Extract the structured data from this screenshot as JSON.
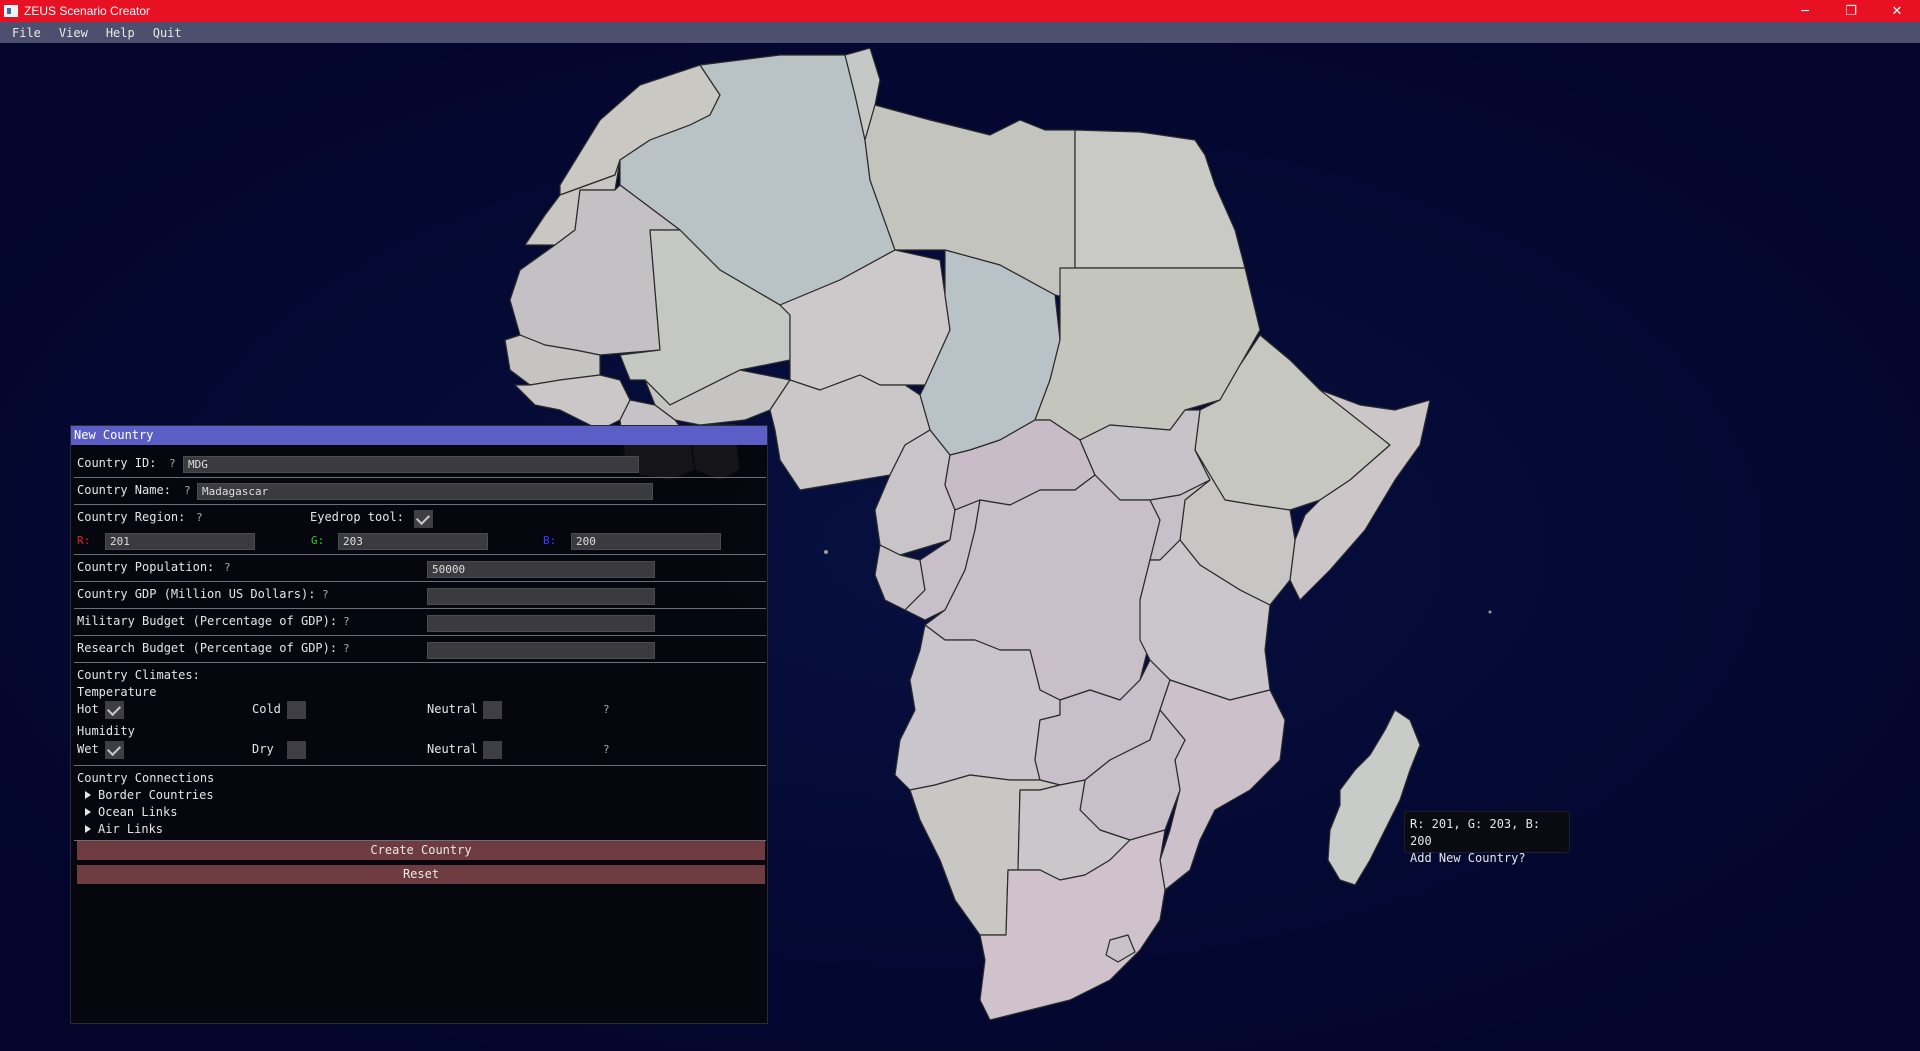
{
  "window": {
    "title": "ZEUS Scenario Creator",
    "minimize_glyph": "─",
    "restore_glyph": "❐",
    "close_glyph": "✕"
  },
  "menu": {
    "items": [
      "File",
      "View",
      "Help",
      "Quit"
    ]
  },
  "panel": {
    "title": "New Country",
    "help_mark": "?",
    "country_id": {
      "label": "Country ID:",
      "value": "MDG"
    },
    "country_name": {
      "label": "Country Name:",
      "value": "Madagascar"
    },
    "region": {
      "label": "Country Region:",
      "eyedrop_label": "Eyedrop tool:",
      "eyedrop_checked": true,
      "r_label": "R:",
      "r_value": "201",
      "r_color": "#e02020",
      "g_label": "G:",
      "g_value": "203",
      "g_color": "#20d020",
      "b_label": "B:",
      "b_value": "200",
      "b_color": "#3040ff"
    },
    "population": {
      "label": "Country Population:",
      "value": "50000"
    },
    "gdp": {
      "label": "Country GDP (Million US Dollars):",
      "value": ""
    },
    "military": {
      "label": "Military Budget (Percentage of GDP):",
      "value": ""
    },
    "research": {
      "label": "Research Budget (Percentage of GDP):",
      "value": ""
    },
    "climates": {
      "label": "Country Climates:",
      "temperature_label": "Temperature",
      "hot_label": "Hot",
      "hot_checked": true,
      "cold_label": "Cold",
      "cold_checked": false,
      "temp_neutral_label": "Neutral",
      "temp_neutral_checked": false,
      "humidity_label": "Humidity",
      "wet_label": "Wet",
      "wet_checked": true,
      "dry_label": "Dry",
      "dry_checked": false,
      "hum_neutral_label": "Neutral",
      "hum_neutral_checked": false
    },
    "connections": {
      "label": "Country Connections",
      "items": [
        "Border Countries",
        "Ocean Links",
        "Air Links"
      ]
    },
    "create_button": "Create Country",
    "reset_button": "Reset"
  },
  "tooltip": {
    "line1": "R: 201, G: 203, B: 200",
    "line2": "Add New Country?"
  },
  "colors": {
    "titlebar": "#e81123",
    "menubar": "#4e4f6e",
    "ocean": "#03052b",
    "panel_header": "#5b5ec6",
    "button": "#6e3c40"
  }
}
